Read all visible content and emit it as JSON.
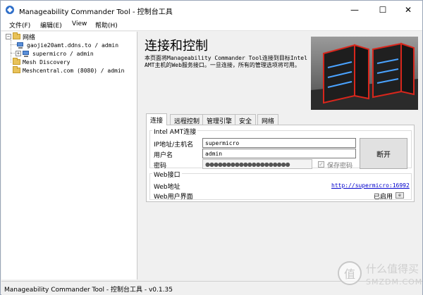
{
  "window": {
    "title": "Manageability Commander Tool - 控制台工具",
    "minimize": "—",
    "maximize": "☐",
    "close": "✕"
  },
  "menu": {
    "items": [
      "文件(F)",
      "编辑(E)",
      "View",
      "帮助(H)"
    ]
  },
  "tree": {
    "root": {
      "label": "网络",
      "expander": "−"
    },
    "children": [
      {
        "label": "gaojie20amt.ddns.to / admin",
        "expander": ""
      },
      {
        "label": "supermicro / admin",
        "expander": "+"
      }
    ],
    "top_level": [
      {
        "label": "Mesh Discovery"
      },
      {
        "label": "Meshcentral.com (8080) / admin"
      }
    ]
  },
  "main": {
    "heading": "连接和控制",
    "description": "本页面将Manageability Commander Tool连接到目标Intel AMT主机的Web服务接口。一旦连接，所有的管理选项将可用。",
    "tabs": [
      "连接",
      "远程控制",
      "管理引擎",
      "安全",
      "网络"
    ],
    "active_tab": 0
  },
  "connection": {
    "group_title": "Intel AMT连接",
    "host_label": "IP地址/主机名",
    "host_value": "supermicro",
    "user_label": "用户名",
    "user_value": "admin",
    "password_label": "密码",
    "password_mask": "●●●●●●●●●●●●●●●●●●●●",
    "save_password_label": "保存密码",
    "save_password_checked": true,
    "disconnect_label": "断开"
  },
  "web": {
    "group_title": "Web接口",
    "address_label": "Web地址",
    "address_value": "http://supermicro:16992",
    "ui_label": "Web用户界面",
    "ui_status": "已启用",
    "ui_icon": "e"
  },
  "statusbar": {
    "text": "Manageability Commander Tool - 控制台工具 - v0.1.35"
  },
  "watermark": {
    "glyph": "值",
    "line1": "什么值得买",
    "line2": "SMZDM.COM"
  },
  "colors": {
    "link": "#0000cc",
    "folder": "#e8c25a",
    "accent_red": "#d8261c"
  }
}
